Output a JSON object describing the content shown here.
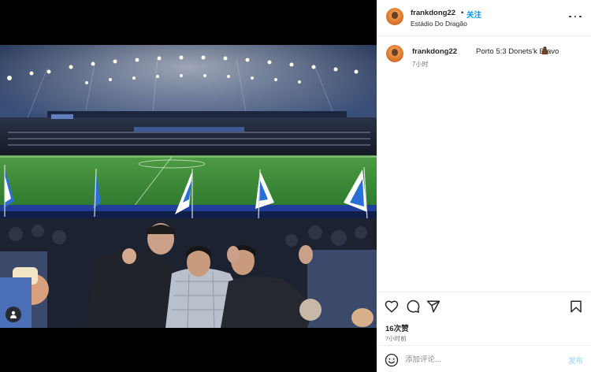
{
  "post": {
    "username": "frankdong22",
    "separator": "•",
    "follow_label": "关注",
    "location": "Estádio Do Dragão",
    "caption_user": "frankdong22",
    "caption_text": "Porto 5:3 Donets'k Bravo",
    "caption_emoji": "bottle-emoji-icon",
    "caption_time": "7小时",
    "likes": "16次赞",
    "post_time": "7小时前"
  },
  "comment": {
    "placeholder": "添加评论...",
    "post_label": "发布"
  },
  "colors": {
    "accent": "#0095f6",
    "post_disabled": "#b2dffc",
    "pitch_green": "#3f8f3a",
    "flag_blue": "#2a6fd6"
  }
}
